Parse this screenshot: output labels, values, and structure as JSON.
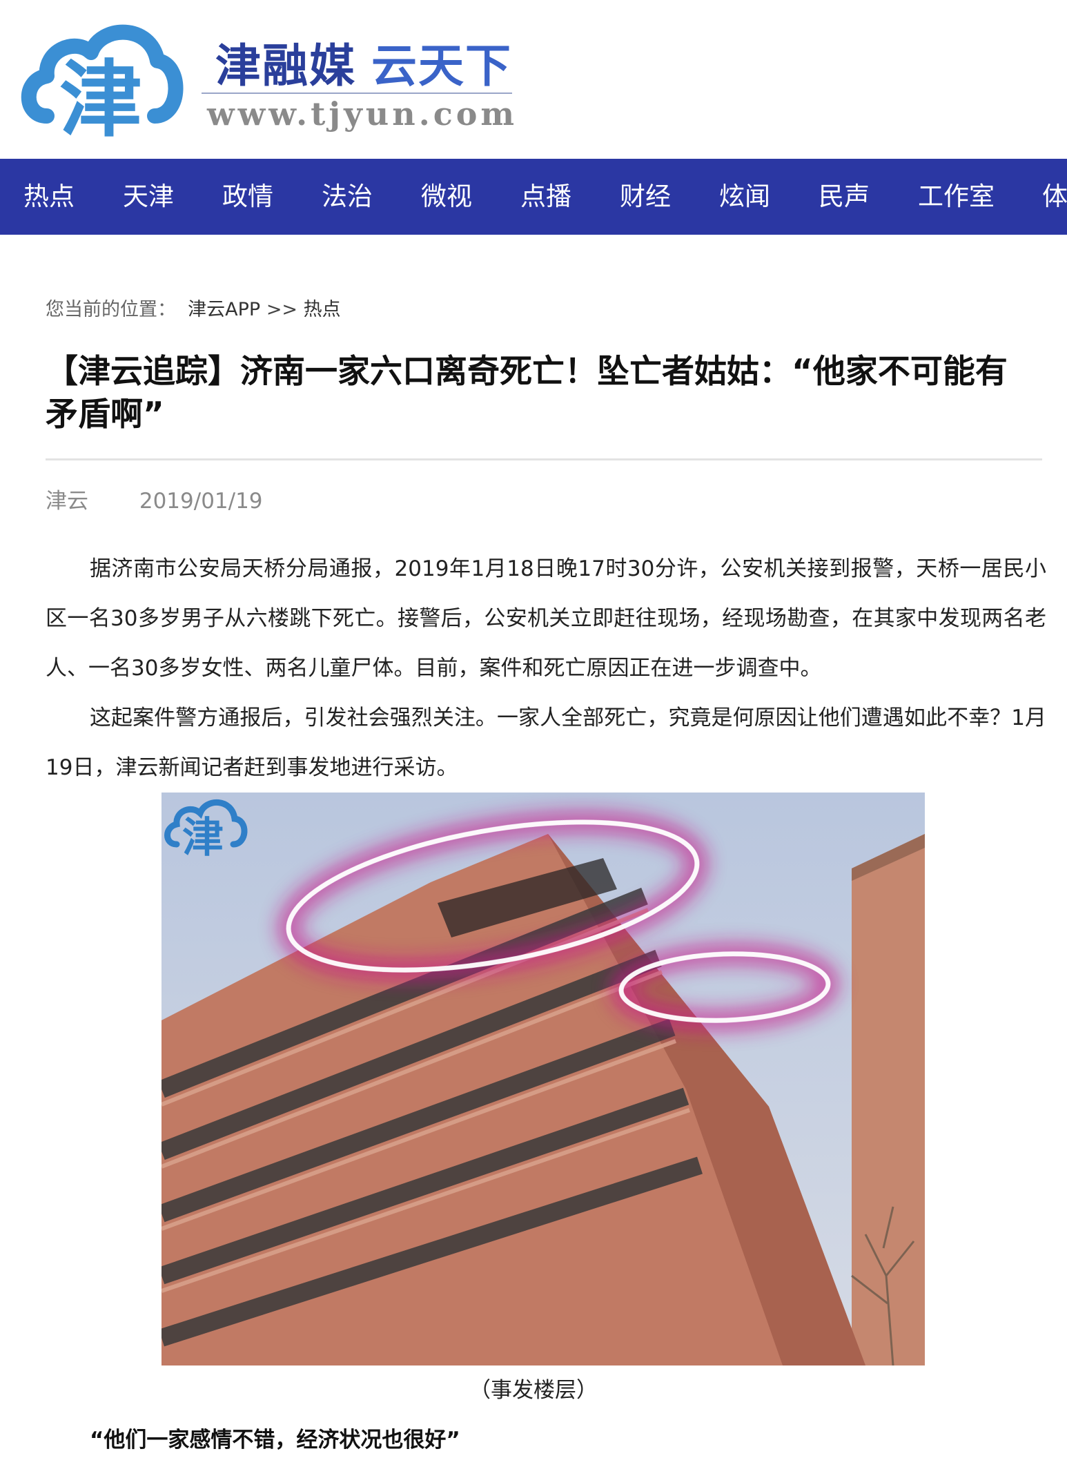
{
  "header": {
    "slogan_part1": "津融媒",
    "slogan_part2": "云天下",
    "domain": "www.tjyun.com",
    "logo_char": "津",
    "brand_color": "#3b8fd4"
  },
  "nav": {
    "background": "#2b37a3",
    "items": [
      "热点",
      "天津",
      "政情",
      "法治",
      "微视",
      "点播",
      "财经",
      "炫闻",
      "民声",
      "工作室",
      "体"
    ]
  },
  "breadcrumb": {
    "label": "您当前的位置：",
    "path": [
      "津云APP",
      ">>",
      "热点"
    ]
  },
  "article": {
    "title": "【津云追踪】济南一家六口离奇死亡！坠亡者姑姑：“他家不可能有矛盾啊”",
    "source": "津云",
    "date": "2019/01/19",
    "paragraphs": [
      "据济南市公安局天桥分局通报，2019年1月18日晚17时30分许，公安机关接到报警，天桥一居民小区一名30多岁男子从六楼跳下死亡。接警后，公安机关立即赶往现场，经现场勘查，在其家中发现两名老人、一名30多岁女性、两名儿童尸体。目前，案件和死亡原因正在进一步调查中。",
      "这起案件警方通报后，引发社会强烈关注。一家人全部死亡，究竟是何原因让他们遭遇如此不幸？1月19日，津云新闻记者赶到事发地进行采访。"
    ],
    "photo": {
      "watermark_char": "津",
      "caption": "（事发楼层）"
    },
    "subheading": "“他们一家感情不错，经济状况也很好”"
  }
}
